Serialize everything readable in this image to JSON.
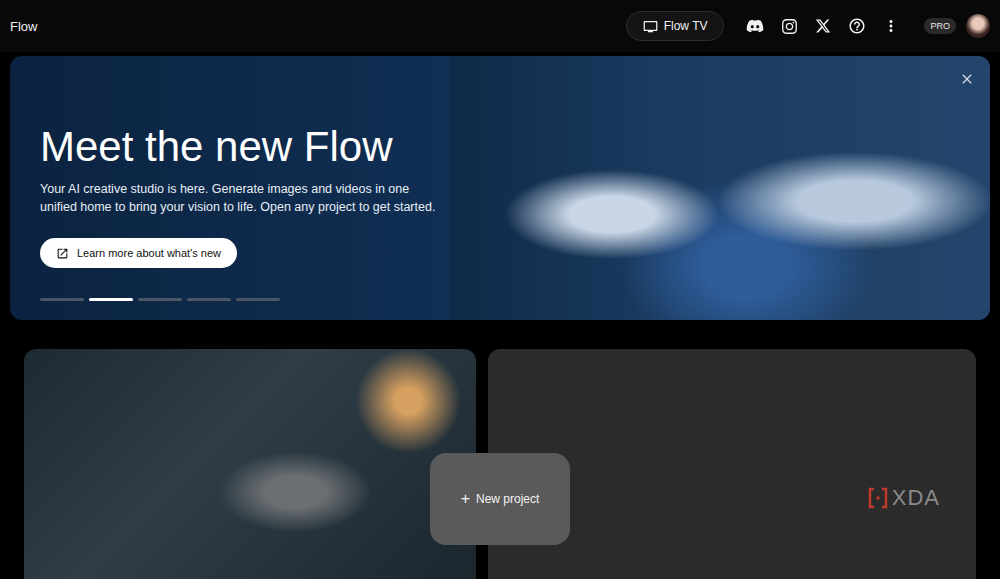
{
  "app": {
    "title": "Flow"
  },
  "toolbar": {
    "flow_tv": "Flow TV",
    "badge": "PRO"
  },
  "hero": {
    "title": "Meet the new Flow",
    "description": "Your AI creative studio is here. Generate images and videos in one unified home to bring your vision to life. Open any project to get started.",
    "button": "Learn more about what's new",
    "slides": [
      {
        "selected": false
      },
      {
        "selected": true
      },
      {
        "selected": false
      },
      {
        "selected": false
      },
      {
        "selected": false
      }
    ]
  },
  "new_project": {
    "icon": "+",
    "label": "New project"
  },
  "watermark": "XDA"
}
